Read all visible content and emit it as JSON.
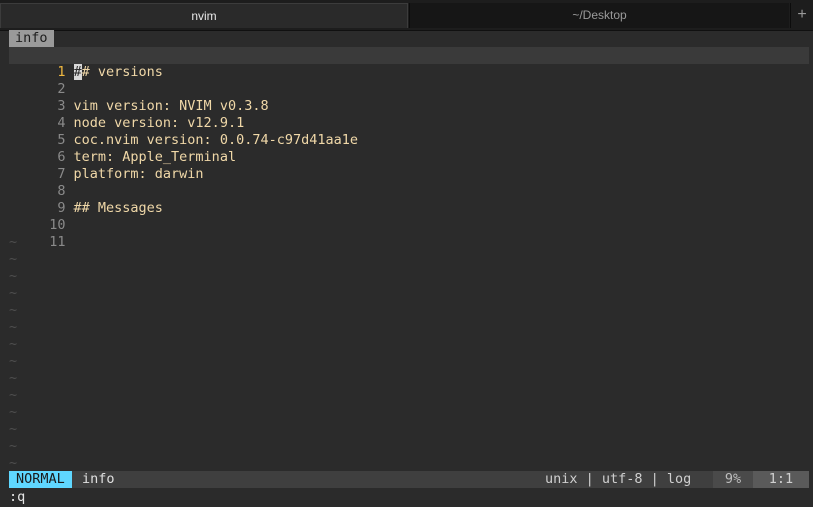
{
  "tabs": {
    "active": "nvim",
    "inactive": "~/Desktop",
    "add": "+"
  },
  "buffer_tab": "info",
  "lines": [
    {
      "num": "1",
      "text": "## versions"
    },
    {
      "num": "2",
      "text": ""
    },
    {
      "num": "3",
      "text": "vim version: NVIM v0.3.8"
    },
    {
      "num": "4",
      "text": "node version: v12.9.1"
    },
    {
      "num": "5",
      "text": "coc.nvim version: 0.0.74-c97d41aa1e"
    },
    {
      "num": "6",
      "text": "term: Apple_Terminal"
    },
    {
      "num": "7",
      "text": "platform: darwin"
    },
    {
      "num": "8",
      "text": ""
    },
    {
      "num": "9",
      "text": "## Messages"
    },
    {
      "num": "10",
      "text": ""
    },
    {
      "num": "11",
      "text": ""
    }
  ],
  "first_line": {
    "cursor_char": "#",
    "rest": "# versions"
  },
  "tilde": "~",
  "status": {
    "mode": "NORMAL",
    "file": "info",
    "encoding": "unix | utf-8 | log",
    "percent": "9%",
    "position": "1:1"
  },
  "command": ":q"
}
